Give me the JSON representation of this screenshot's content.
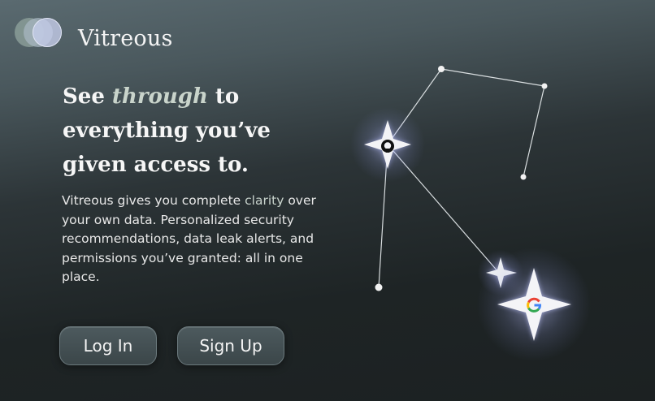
{
  "brand": {
    "name": "Vitreous"
  },
  "hero": {
    "headline_pre": "See ",
    "headline_emph": "through",
    "headline_post": " to everything you’ve given access to.",
    "desc_pre": "Vitreous gives you complete ",
    "desc_emph": "clarity",
    "desc_post": " over your own data. Personalized security recommendations, data leak alerts, and permissions you’ve granted: all in one place."
  },
  "buttons": {
    "login": "Log In",
    "signup": "Sign Up"
  },
  "constellation": {
    "icons": [
      "github-icon",
      "google-icon"
    ],
    "colors": {
      "star": "#f3f3f6",
      "glow": "#b9c0ff",
      "line": "#d9dee0"
    }
  }
}
